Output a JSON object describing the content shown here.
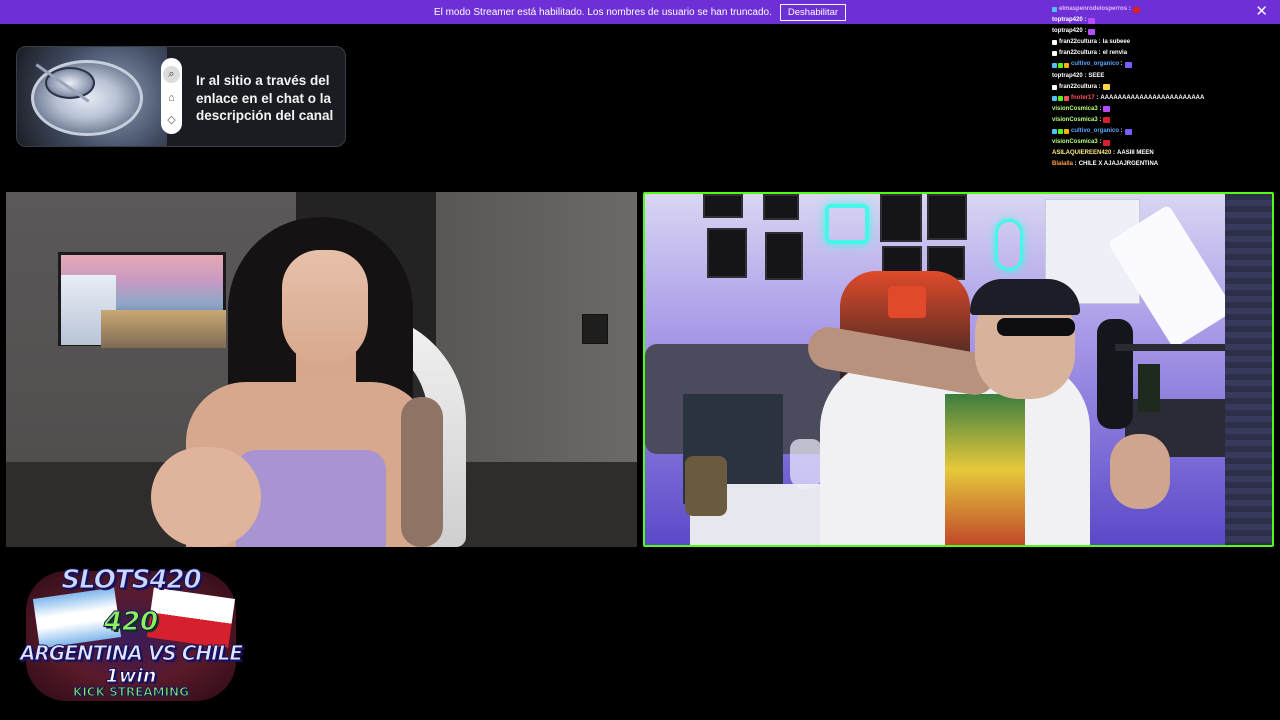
{
  "banner": {
    "text": "El modo Streamer está habilitado. Los nombres de usuario se han truncado.",
    "button_label": "Deshabilitar",
    "close_symbol": "✕",
    "color": "#6e2fd6"
  },
  "chat": {
    "messages": [
      {
        "user": "elmaspenrodelosperros",
        "message": "",
        "user_color": "pink",
        "badges": [
          "#4fc3f7"
        ],
        "emote": "#d7202e"
      },
      {
        "user": "toptrap420",
        "message": "",
        "user_color": "white",
        "badges": [],
        "emote": "#b84dff"
      },
      {
        "user": "toptrap420",
        "message": "",
        "user_color": "white",
        "badges": [],
        "emote": "#b84dff"
      },
      {
        "user": "fran22cultura",
        "message": "la subeee",
        "user_color": "white",
        "badges": [
          "#ffffff"
        ],
        "emote": ""
      },
      {
        "user": "fran22cultura",
        "message": "el renvia",
        "user_color": "white",
        "badges": [
          "#ffffff"
        ],
        "emote": ""
      },
      {
        "user": "cultivo_organico",
        "message": "",
        "user_color": "blue",
        "badges": [
          "#4fc3f7",
          "#53fc18",
          "#ffb000"
        ],
        "emote": "#7a5cff"
      },
      {
        "user": "toptrap420",
        "message": "SEEE",
        "user_color": "white",
        "badges": [],
        "emote": ""
      },
      {
        "user": "fran22cultura",
        "message": "",
        "user_color": "white",
        "badges": [
          "#ffffff"
        ],
        "emote": "#ffd54f"
      },
      {
        "user": "fnoter17",
        "message": "AAAAAAAAAAAAAAAAAAAAAAAA",
        "user_color": "red",
        "badges": [
          "#4fc3f7",
          "#53fc18",
          "#ff4d5e"
        ],
        "emote": ""
      },
      {
        "user": "visionCosmica3",
        "message": "",
        "user_color": "green",
        "badges": [],
        "emote": "#b84dff"
      },
      {
        "user": "visionCosmica3",
        "message": "",
        "user_color": "green",
        "badges": [],
        "emote": "#d7202e"
      },
      {
        "user": "cultivo_organico",
        "message": "",
        "user_color": "blue",
        "badges": [
          "#4fc3f7",
          "#53fc18",
          "#ffb000"
        ],
        "emote": "#7a5cff"
      },
      {
        "user": "visionCosmica3",
        "message": "",
        "user_color": "green",
        "badges": [],
        "emote": "#d7202e"
      },
      {
        "user": "ASILAQUIEREEN420",
        "message": "AASIII MEEN",
        "user_color": "yellow",
        "badges": [],
        "emote": ""
      },
      {
        "user": "Blalalla",
        "message": "CHILE X AJAJAJRGENTINA",
        "user_color": "orange",
        "badges": [],
        "emote": ""
      }
    ]
  },
  "promo": {
    "text": "Ir al sitio a través del enlace en el chat o la descripción del canal",
    "icons": [
      "search-icon",
      "gift-icon",
      "tag-icon"
    ],
    "icon_glyphs": [
      "⌕",
      "⌂",
      "◇"
    ]
  },
  "cams": {
    "left": {
      "label": ""
    },
    "right": {
      "label": "",
      "border_color": "#53fc18"
    }
  },
  "logo": {
    "line1": "SLOTS420",
    "line2": "420",
    "line3": "ARGENTINA VS CHILE",
    "line4": "1win",
    "line5": "KICK STREAMING"
  }
}
